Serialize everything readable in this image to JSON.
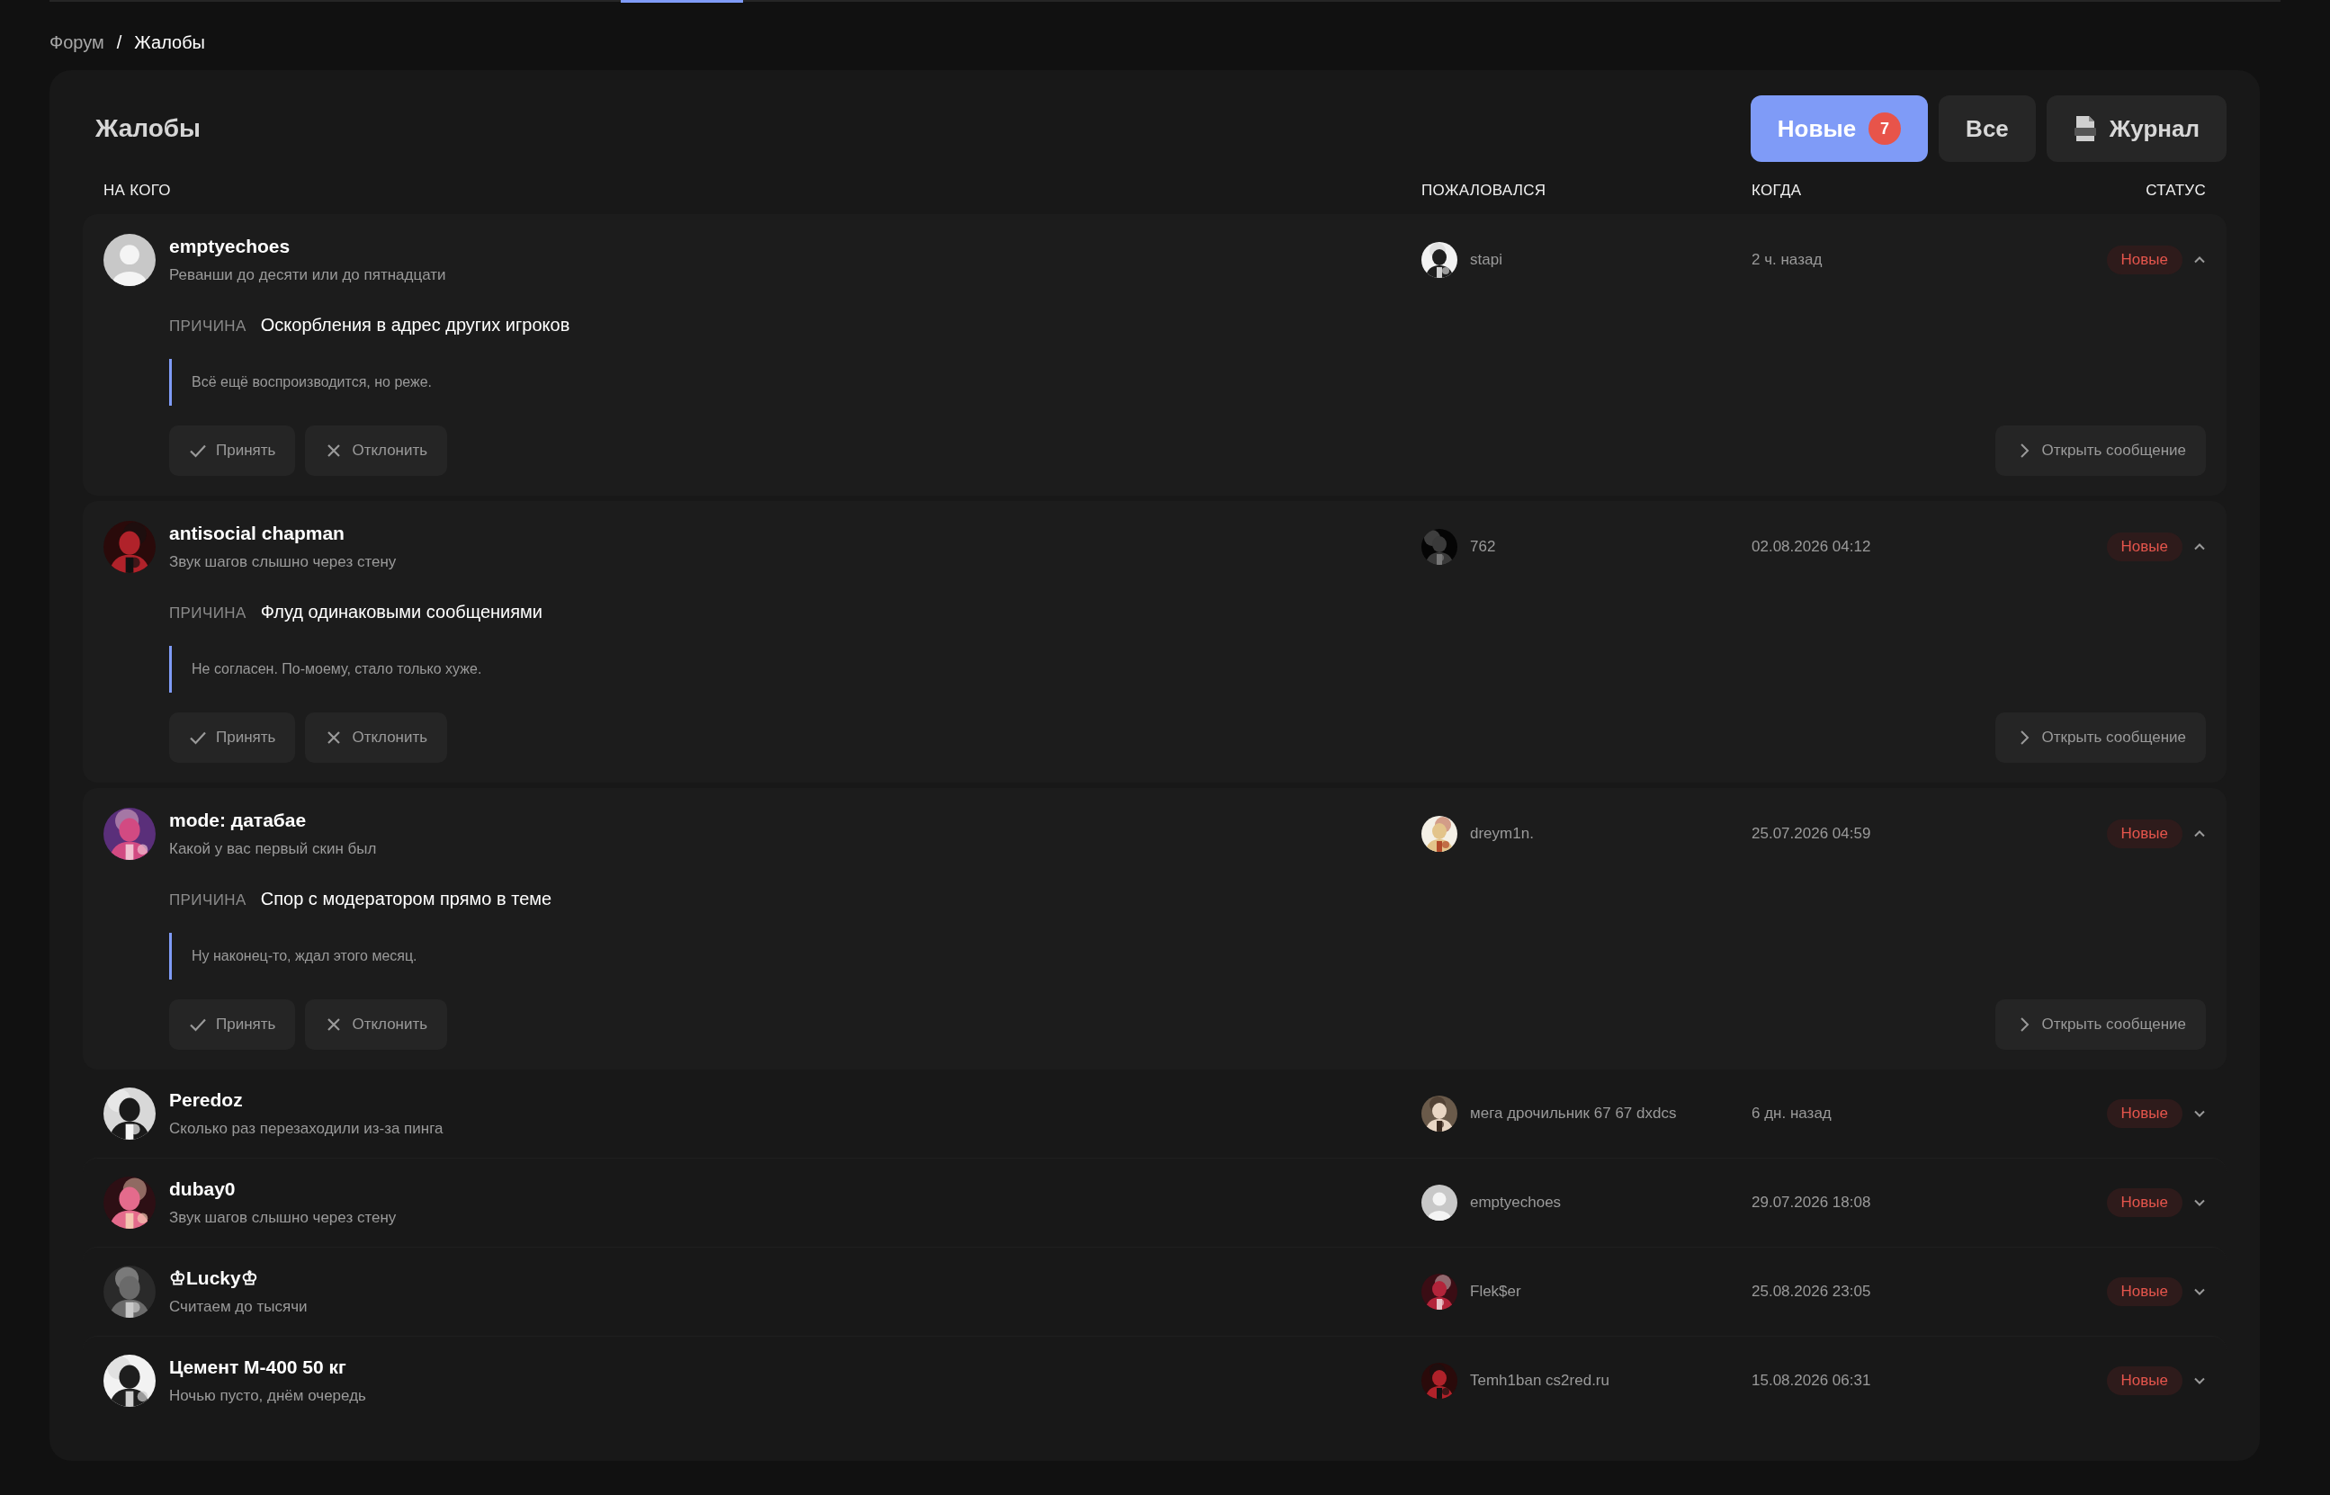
{
  "breadcrumb": {
    "items": [
      {
        "label": "Форум",
        "selected": false
      },
      {
        "label": "Жалобы",
        "selected": true
      }
    ],
    "separator": "/"
  },
  "title": "Жалобы",
  "filters": [
    {
      "kind": "tab",
      "label": "Новые",
      "badge": "7",
      "selected": true
    },
    {
      "kind": "tab",
      "label": "Все",
      "selected": false
    },
    {
      "kind": "log",
      "label": "Журнал",
      "selected": false
    }
  ],
  "columns": [
    "НА КОГО",
    "ПОЖАЛОВАЛСЯ",
    "КОГДА",
    "СТАТУС"
  ],
  "reports": [
    {
      "user": "emptyechoes",
      "avatar": {
        "kind": "default"
      },
      "topic": "Реванши до десяти или до пятнадцати",
      "complainant": "stapi",
      "complainant_avatar": {
        "kind": "picture"
      },
      "when": "2 ч. назад",
      "status": "Новые",
      "expanded": true,
      "reason_label": "ПРИЧИНА",
      "reason": "Оскорбления в адрес других игроков",
      "quote": "Всё ещё воспроизводится, но реже.",
      "actions": [
        {
          "kind": "accept",
          "label": "Принять"
        },
        {
          "kind": "reject",
          "label": "Отклонить"
        }
      ],
      "open_label": "Открыть сообщение"
    },
    {
      "user": "antisocial chapman",
      "avatar": {
        "kind": "picture"
      },
      "topic": "Звук шагов слышно через стену",
      "complainant": "762",
      "complainant_avatar": {
        "kind": "picture"
      },
      "when": "02.08.2026 04:12",
      "status": "Новые",
      "expanded": true,
      "reason_label": "ПРИЧИНА",
      "reason": "Флуд одинаковыми сообщениями",
      "quote": "Не согласен. По-моему, стало только хуже.",
      "actions": [
        {
          "kind": "accept",
          "label": "Принять"
        },
        {
          "kind": "reject",
          "label": "Отклонить"
        }
      ],
      "open_label": "Открыть сообщение"
    },
    {
      "user": "mode: датабае",
      "avatar": {
        "kind": "picture"
      },
      "topic": "Какой у вас первый скин был",
      "complainant": "dreym1n.",
      "complainant_avatar": {
        "kind": "picture"
      },
      "when": "25.07.2026 04:59",
      "status": "Новые",
      "expanded": true,
      "reason_label": "ПРИЧИНА",
      "reason": "Спор с модератором прямо в теме",
      "quote": "Ну наконец-то, ждал этого месяц.",
      "actions": [
        {
          "kind": "accept",
          "label": "Принять"
        },
        {
          "kind": "reject",
          "label": "Отклонить"
        }
      ],
      "open_label": "Открыть сообщение"
    },
    {
      "user": "Peredoz",
      "avatar": {
        "kind": "picture"
      },
      "topic": "Сколько раз перезаходили из-за пинга",
      "complainant": "мега дрочильник 67 67 dxdcs",
      "complainant_avatar": {
        "kind": "picture"
      },
      "when": "6 дн. назад",
      "status": "Новые",
      "expanded": false
    },
    {
      "user": "dubay0",
      "avatar": {
        "kind": "picture"
      },
      "topic": "Звук шагов слышно через стену",
      "complainant": "emptyechoes",
      "complainant_avatar": {
        "kind": "default"
      },
      "when": "29.07.2026 18:08",
      "status": "Новые",
      "expanded": false
    },
    {
      "user": "♔Lucky♔",
      "avatar": {
        "kind": "picture"
      },
      "topic": "Считаем до тысячи",
      "complainant": "Flek$er",
      "complainant_avatar": {
        "kind": "picture"
      },
      "when": "25.08.2026 23:05",
      "status": "Новые",
      "expanded": false
    },
    {
      "user": "Цемент М-400 50 кг",
      "avatar": {
        "kind": "picture"
      },
      "topic": "Ночью пусто, днём очередь",
      "complainant": "Temh1ban cs2red.ru",
      "complainant_avatar": {
        "kind": "picture"
      },
      "when": "15.08.2026 06:31",
      "status": "Новые",
      "expanded": false
    }
  ]
}
